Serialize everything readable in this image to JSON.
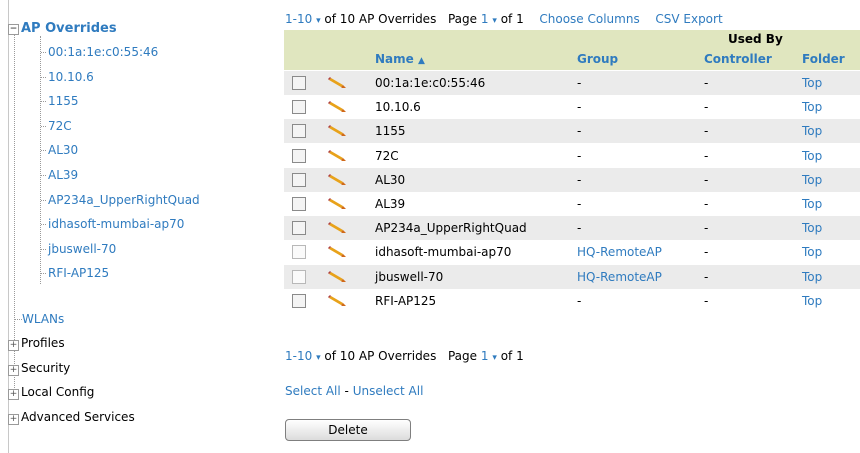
{
  "sidebar": {
    "root_toggle": "−",
    "root_label": "AP Overrides",
    "children": [
      "00:1a:1e:c0:55:46",
      "10.10.6",
      "1155",
      "72C",
      "AL30",
      "AL39",
      "AP234a_UpperRightQuad",
      "idhasoft-mumbai-ap70",
      "jbuswell-70",
      "RFI-AP125"
    ],
    "wlans": "WLANs",
    "sections": [
      "Profiles",
      "Security",
      "Local Config",
      "Advanced Services"
    ],
    "section_toggle": "+"
  },
  "pager_top": {
    "range": "1-10",
    "arrow": "▾",
    "of_text": "of 10 AP Overrides",
    "page_label": "Page",
    "page_num": "1",
    "page_of": "of 1",
    "choose_columns": "Choose Columns",
    "csv_export": "CSV Export"
  },
  "pager_bottom": {
    "range": "1-10",
    "arrow": "▾",
    "of_text": "of 10 AP Overrides",
    "page_label": "Page",
    "page_num": "1",
    "page_of": "of 1"
  },
  "table": {
    "group_header": "Used By",
    "columns": {
      "name": "Name",
      "sort": "▲",
      "group": "Group",
      "controller": "Controller",
      "folder": "Folder"
    },
    "rows": [
      {
        "name": "00:1a:1e:c0:55:46",
        "group": "-",
        "controller": "-",
        "folder": "Top",
        "enabled": true
      },
      {
        "name": "10.10.6",
        "group": "-",
        "controller": "-",
        "folder": "Top",
        "enabled": true
      },
      {
        "name": "1155",
        "group": "-",
        "controller": "-",
        "folder": "Top",
        "enabled": true
      },
      {
        "name": "72C",
        "group": "-",
        "controller": "-",
        "folder": "Top",
        "enabled": true
      },
      {
        "name": "AL30",
        "group": "-",
        "controller": "-",
        "folder": "Top",
        "enabled": true
      },
      {
        "name": "AL39",
        "group": "-",
        "controller": "-",
        "folder": "Top",
        "enabled": true
      },
      {
        "name": "AP234a_UpperRightQuad",
        "group": "-",
        "controller": "-",
        "folder": "Top",
        "enabled": true
      },
      {
        "name": "idhasoft-mumbai-ap70",
        "group": "HQ-RemoteAP",
        "controller": "-",
        "folder": "Top",
        "enabled": false
      },
      {
        "name": "jbuswell-70",
        "group": "HQ-RemoteAP",
        "controller": "-",
        "folder": "Top",
        "enabled": false
      },
      {
        "name": "RFI-AP125",
        "group": "-",
        "controller": "-",
        "folder": "Top",
        "enabled": true
      }
    ]
  },
  "actions": {
    "select_all": "Select All",
    "separator": " - ",
    "unselect_all": "Unselect All",
    "delete": "Delete"
  },
  "colors": {
    "link": "#2f7bbf",
    "header_bg": "#e0e6bf",
    "row_alt": "#ebebeb"
  },
  "icons": {
    "row_edit": "pencil-icon",
    "tree_expand": "plus-box-icon",
    "tree_collapse": "minus-box-icon"
  }
}
